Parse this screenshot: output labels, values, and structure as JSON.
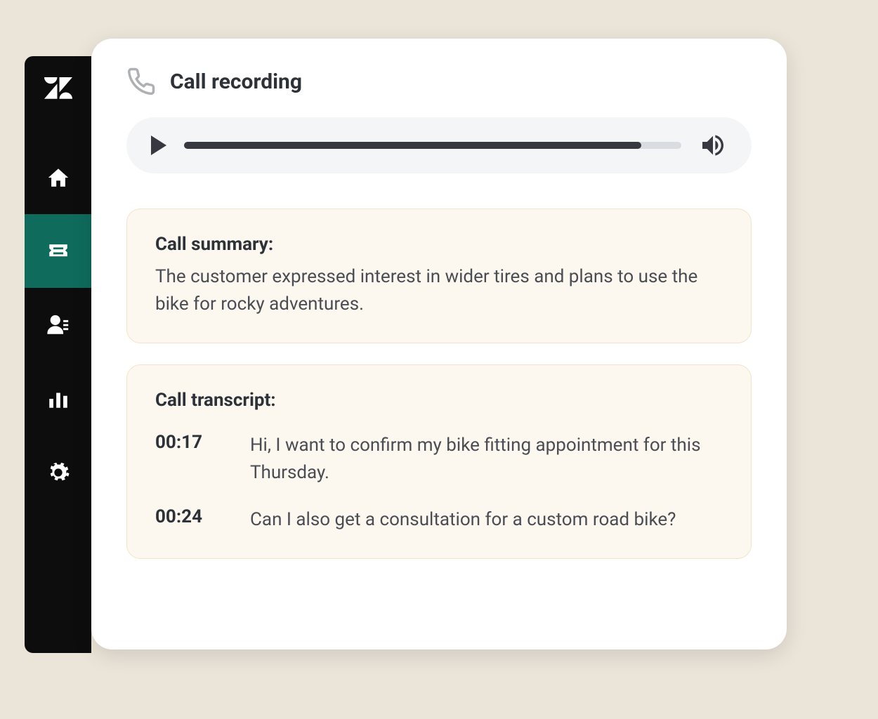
{
  "header": {
    "title": "Call recording"
  },
  "audio": {
    "progress_percent": 92
  },
  "summary": {
    "label": "Call summary:",
    "text": "The customer expressed interest in wider tires and plans to use the bike for rocky adventures."
  },
  "transcript": {
    "label": "Call transcript:",
    "entries": [
      {
        "time": "00:17",
        "text": "Hi, I want to confirm my bike fitting appointment for this Thursday."
      },
      {
        "time": "00:24",
        "text": "Can I also get a consultation for a custom road bike?"
      }
    ]
  },
  "sidebar": {
    "items": [
      "home",
      "tickets",
      "users",
      "analytics",
      "settings"
    ]
  }
}
